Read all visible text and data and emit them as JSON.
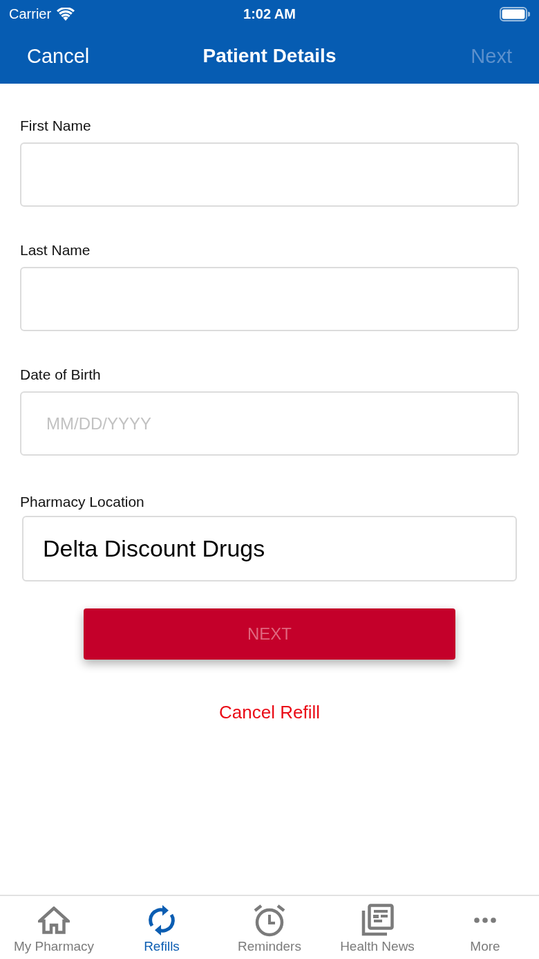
{
  "status_bar": {
    "carrier": "Carrier",
    "time": "1:02 AM"
  },
  "nav": {
    "cancel": "Cancel",
    "title": "Patient Details",
    "next": {
      "label": "Next",
      "disabled": true
    }
  },
  "fields": [
    {
      "kind": "text",
      "label": "First Name"
    },
    {
      "kind": "text",
      "label": "Last Name"
    },
    {
      "kind": "text",
      "label": "Date of Birth",
      "placeholder": "MM/DD/YYYY"
    },
    {
      "kind": "picker",
      "label": "Pharmacy Location",
      "value": "Delta Discount Drugs"
    }
  ],
  "next_button": {
    "label": "NEXT",
    "disabled": true
  },
  "cancel_link": "Cancel Refill",
  "tabs": [
    {
      "label": "My Pharmacy",
      "selected": false
    },
    {
      "label": "Refills",
      "selected": true
    },
    {
      "label": "Reminders",
      "selected": false
    },
    {
      "label": "Health News",
      "selected": false
    },
    {
      "label": "More",
      "selected": false
    }
  ]
}
